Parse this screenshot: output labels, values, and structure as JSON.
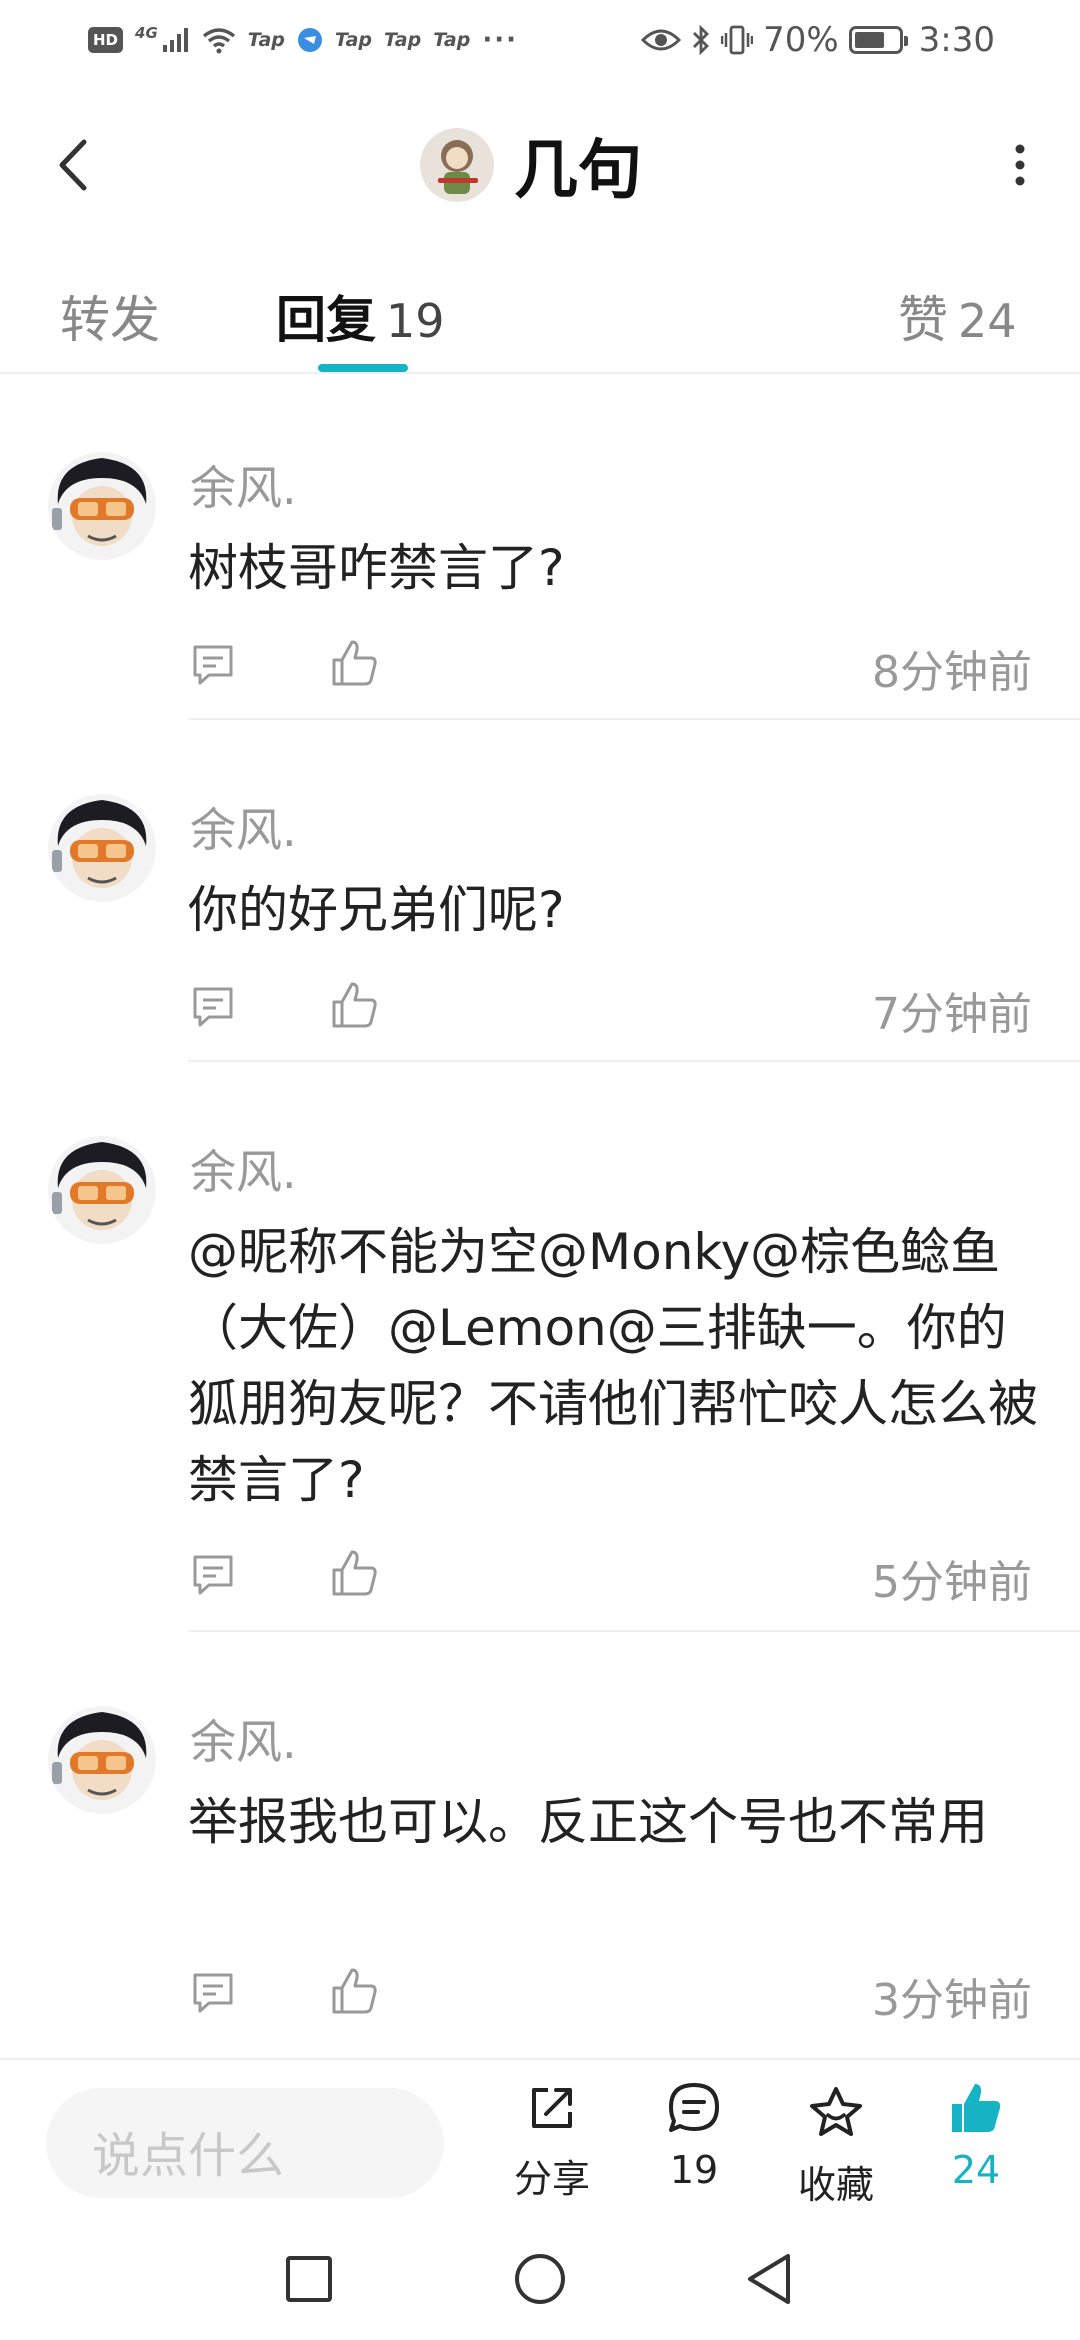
{
  "status_bar": {
    "hd": "HD",
    "network": "4G",
    "apps": [
      "Tap",
      "Tap",
      "Tap",
      "Tap"
    ],
    "more": "···",
    "battery_text": "70%",
    "battery_level": 0.7,
    "time": "3:30"
  },
  "header": {
    "title": "几句"
  },
  "tabs": [
    {
      "label": "转发",
      "count": ""
    },
    {
      "label": "回复",
      "count": "19"
    },
    {
      "label": "赞",
      "count": "24"
    }
  ],
  "accent_color": "#16b3c4",
  "comments": [
    {
      "author": "余风.",
      "text": "树枝哥咋禁言了?",
      "time": "8分钟前"
    },
    {
      "author": "余风.",
      "text": "你的好兄弟们呢?",
      "time": "7分钟前"
    },
    {
      "author": "余风.",
      "text": "@昵称不能为空@Monky@棕色鲶鱼（大佐）@Lemon@三排缺一。你的狐朋狗友呢？不请他们帮忙咬人怎么被禁言了?",
      "time": "5分钟前"
    },
    {
      "author": "余风.",
      "text": "举报我也可以。反正这个号也不常用",
      "time": "3分钟前"
    }
  ],
  "bottom_bar": {
    "input_placeholder": "说点什么",
    "share_label": "分享",
    "comment_count": "19",
    "favorite_label": "收藏",
    "like_count": "24"
  }
}
